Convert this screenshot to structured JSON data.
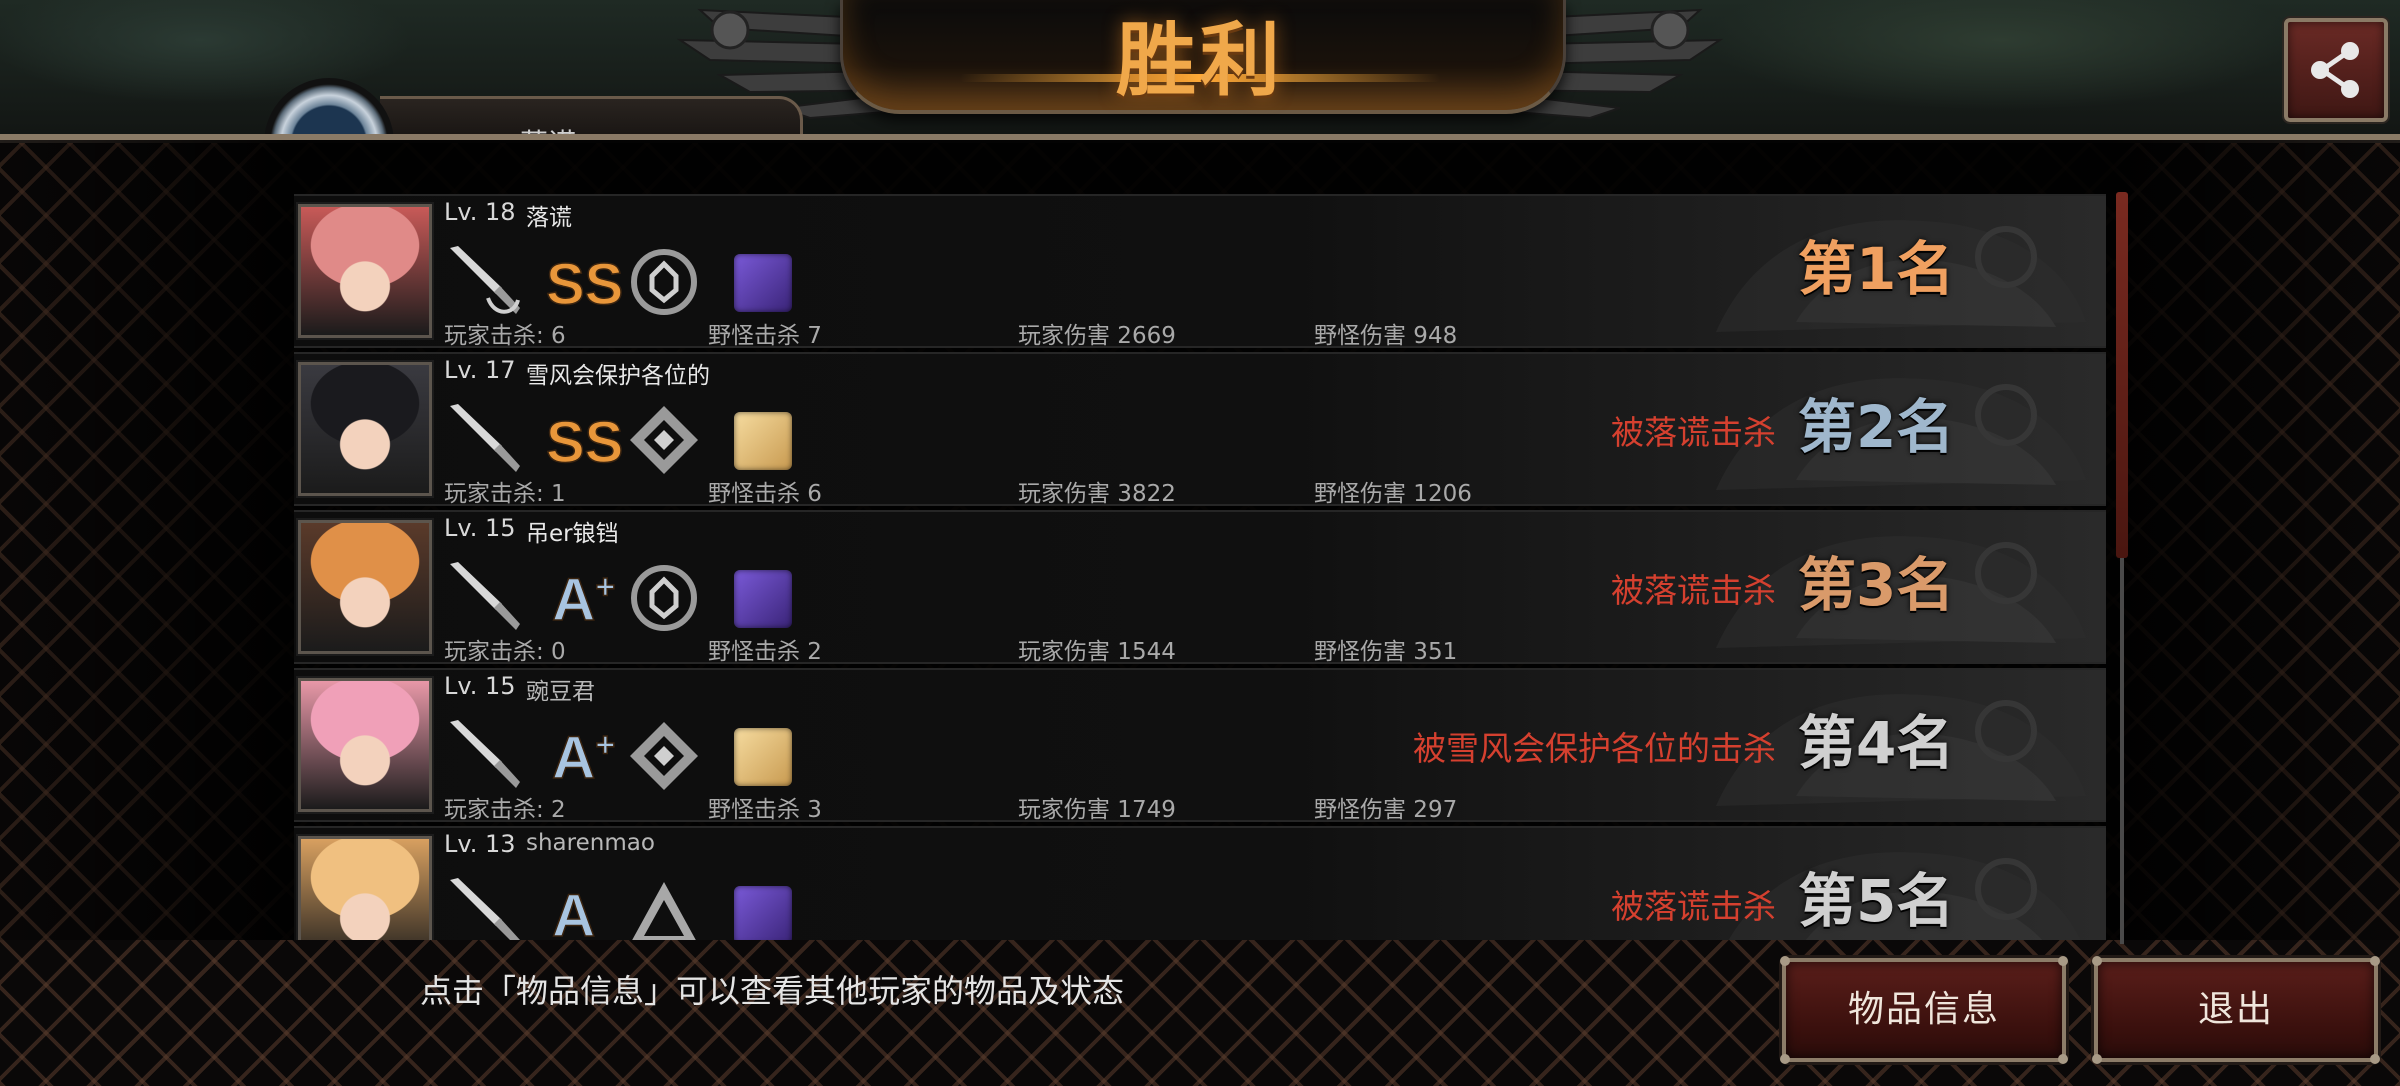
{
  "header": {
    "title": "胜利",
    "self_name": "落谎"
  },
  "players": [
    {
      "level": "Lv. 18",
      "name": "落谎",
      "weapon": "knife-icon",
      "grade": "SS",
      "rune": "rune-icon",
      "item": "purple-item-icon",
      "player_kills": "玩家击杀: 6",
      "monster_kills": "野怪击杀 7",
      "player_damage": "玩家伤害 2669",
      "monster_damage": "野怪伤害 948",
      "killed_by": "",
      "rank": "第1名",
      "rank_color": "#f0a060",
      "avatar_color": "#c85a58",
      "hair_color": "#e08a88"
    },
    {
      "level": "Lv. 17",
      "name": "雪风会保护各位的",
      "weapon": "knife-icon",
      "grade": "SS",
      "rune": "rune-icon",
      "item": "gold-item-icon",
      "player_kills": "玩家击杀: 1",
      "monster_kills": "野怪击杀 6",
      "player_damage": "玩家伤害 3822",
      "monster_damage": "野怪伤害 1206",
      "killed_by": "被落谎击杀",
      "rank": "第2名",
      "rank_color": "#9fb7cc",
      "avatar_color": "#3a3a40",
      "hair_color": "#1a1a1e"
    },
    {
      "level": "Lv. 15",
      "name": "吊er锒铛",
      "weapon": "knife-icon",
      "grade": "A+",
      "rune": "rune-icon",
      "item": "purple-item-icon",
      "player_kills": "玩家击杀: 0",
      "monster_kills": "野怪击杀 2",
      "player_damage": "玩家伤害 1544",
      "monster_damage": "野怪伤害 351",
      "killed_by": "被落谎击杀",
      "rank": "第3名",
      "rank_color": "#d99a6a",
      "avatar_color": "#5a3a2a",
      "hair_color": "#e09048"
    },
    {
      "level": "Lv. 15",
      "name": "豌豆君",
      "weapon": "knife-icon",
      "grade": "A+",
      "rune": "rune-icon",
      "item": "gold-item-icon",
      "player_kills": "玩家击杀: 2",
      "monster_kills": "野怪击杀 3",
      "player_damage": "玩家伤害 1749",
      "monster_damage": "野怪伤害 297",
      "killed_by": "被雪风会保护各位的击杀",
      "rank": "第4名",
      "rank_color": "#d0d0d0",
      "avatar_color": "#e898a8",
      "hair_color": "#f0a0b8"
    },
    {
      "level": "Lv. 13",
      "name": "sharenmao",
      "weapon": "knife-icon",
      "grade": "A",
      "rune": "rune-icon",
      "item": "purple-item-icon",
      "player_kills": "",
      "monster_kills": "",
      "player_damage": "",
      "monster_damage": "",
      "killed_by": "被落谎击杀",
      "rank": "第5名",
      "rank_color": "#d0d0d0",
      "avatar_color": "#d8a060",
      "hair_color": "#f0c080"
    }
  ],
  "footer": {
    "tip": "点击「物品信息」可以查看其他玩家的物品及状态",
    "items_button": "物品信息",
    "exit_button": "退出"
  }
}
